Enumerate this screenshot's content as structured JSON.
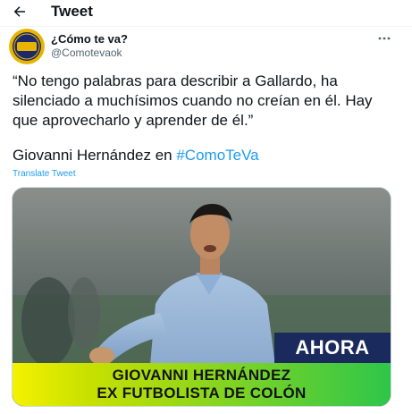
{
  "header": {
    "title": "Tweet",
    "back_icon": "arrow-left-icon"
  },
  "tweet": {
    "author_name": "¿Cómo te va?",
    "author_handle": "@Comotevaok",
    "avatar_text": "¿CÓMO TE VA?",
    "more_icon": "more-dots-icon",
    "text_lines": [
      "“No tengo palabras para describir a Gallardo, ha",
      "silenciado a muchísimos cuando no creían en él. Hay",
      "que aprovecharlo y aprender de él.”"
    ],
    "byline_text": "Giovanni Hernández en ",
    "hashtag": "#ComoTeVa",
    "translate_label": "Translate Tweet"
  },
  "media": {
    "ahora_label": "AHORA",
    "lower_third_line1": "GIOVANNI HERNÁNDEZ",
    "lower_third_line2": "EX FUTBOLISTA DE COLÓN"
  },
  "colors": {
    "accent": "#1d9bf0",
    "ahora_bg": "#1a2a5c",
    "lower_third_start": "#f4f200",
    "lower_third_end": "#2ec64a"
  }
}
